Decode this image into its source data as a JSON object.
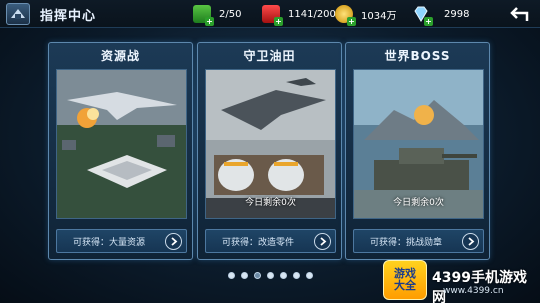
{
  "header": {
    "title": "指挥中心",
    "resources": [
      {
        "name": "energy",
        "icon": "green-energy-icon",
        "value": "2/50"
      },
      {
        "name": "fuel",
        "icon": "red-fuel-can-icon",
        "value": "1141/200"
      },
      {
        "name": "gold",
        "icon": "gold-coin-icon",
        "value": "1034万"
      },
      {
        "name": "diamond",
        "icon": "diamond-icon",
        "value": "2998"
      }
    ]
  },
  "cards": [
    {
      "title": "资源战",
      "remaining": "",
      "footer": "可获得：大量资源"
    },
    {
      "title": "守卫油田",
      "remaining": "今日剩余0次",
      "footer": "可获得：改造零件"
    },
    {
      "title": "世界BOSS",
      "remaining": "今日剩余0次",
      "footer": "可获得：挑战勋章"
    }
  ],
  "pager": {
    "total": 7,
    "active": 2
  },
  "watermark": {
    "logo_line1": "游戏",
    "logo_line2": "大全",
    "text": "4399手机游戏网",
    "url": "www.4399.cn"
  }
}
